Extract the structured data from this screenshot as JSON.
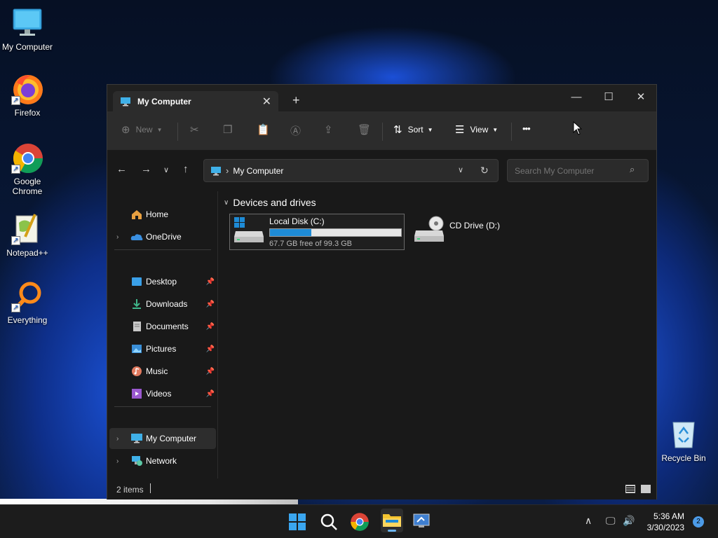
{
  "desktop": {
    "icons": [
      {
        "label": "My Computer",
        "icon": "monitor-icon"
      },
      {
        "label": "Firefox",
        "icon": "firefox-icon"
      },
      {
        "label": "Google Chrome",
        "icon": "chrome-icon"
      },
      {
        "label": "Notepad++",
        "icon": "notepadpp-icon"
      },
      {
        "label": "Everything",
        "icon": "everything-search-icon"
      }
    ],
    "recycle_bin": {
      "label": "Recycle Bin",
      "icon": "recycle-bin-icon"
    }
  },
  "window": {
    "tab_title": "My Computer",
    "tab_close": "✕",
    "new_tab": "+",
    "controls": {
      "minimize": "—",
      "maximize": "☐",
      "close": "✕"
    },
    "toolbar": {
      "new_label": "New",
      "sort_label": "Sort",
      "view_label": "View",
      "more_label": "•••"
    },
    "address": {
      "path_label": "My Computer",
      "separator": "›"
    },
    "search": {
      "placeholder": "Search My Computer"
    },
    "sidebar": {
      "home": "Home",
      "onedrive": "OneDrive",
      "quick_access": [
        {
          "label": "Desktop",
          "icon": "desktop-folder-icon",
          "color": "#3aa0e8"
        },
        {
          "label": "Downloads",
          "icon": "download-icon",
          "color": "#3fb68a"
        },
        {
          "label": "Documents",
          "icon": "documents-icon",
          "color": "#b0b0b0"
        },
        {
          "label": "Pictures",
          "icon": "pictures-icon",
          "color": "#3a8fd8"
        },
        {
          "label": "Music",
          "icon": "music-icon",
          "color": "#e07a5f"
        },
        {
          "label": "Videos",
          "icon": "videos-icon",
          "color": "#9b59d0"
        }
      ],
      "my_computer": "My Computer",
      "network": "Network"
    },
    "content": {
      "group_title": "Devices and drives",
      "drives": [
        {
          "name": "Local Disk (C:)",
          "free_text": "67.7 GB free of 99.3 GB",
          "used_fraction": 0.318
        },
        {
          "name": "CD Drive (D:)"
        }
      ]
    },
    "status": {
      "items": "2 items"
    }
  },
  "taskbar": {
    "time": "5:36 AM",
    "date": "3/30/2023",
    "notification_count": "2",
    "accent": "#1e8bd6"
  }
}
